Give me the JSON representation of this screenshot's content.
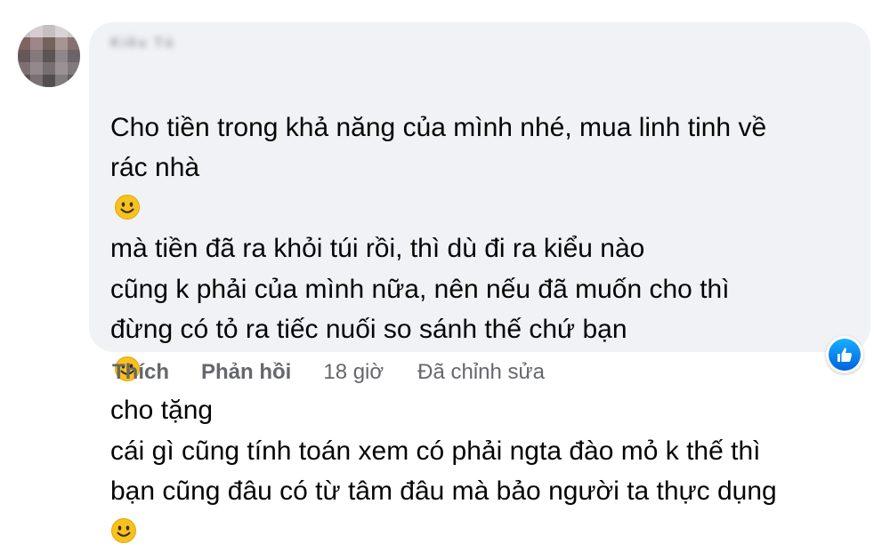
{
  "comment": {
    "author": "Kiều Tú",
    "segments": [
      {
        "type": "text",
        "value": "Cho tiền trong khả năng của mình nhé, mua linh tinh về\nrác nhà"
      },
      {
        "type": "emoji",
        "icon": "smiley-emoji-icon"
      },
      {
        "type": "text",
        "value": "mà tiền đã ra khỏi túi rồi, thì dù đi ra kiểu nào\ncũng k phải của mình nữa, nên nếu đã muốn cho thì\nđừng có tỏ ra tiếc nuối so sánh thế chứ bạn"
      },
      {
        "type": "emoji",
        "icon": "smiley-emoji-icon"
      },
      {
        "type": "text",
        "value": "cho tặng\ncái gì cũng tính toán xem có phải ngta đào mỏ k thế thì\nbạn cũng đâu có từ tâm đâu mà bảo người ta thực dụng\n"
      },
      {
        "type": "emoji",
        "icon": "smiley-emoji-icon"
      }
    ]
  },
  "actions": {
    "like": "Thích",
    "reply": "Phản hồi",
    "time": "18 giờ",
    "edited": "Đã chỉnh sửa"
  },
  "reaction": {
    "icon": "thumbs-up-icon",
    "color": "#1877f2"
  },
  "colors": {
    "bubble": "#f0f2f5",
    "meta": "#65676b",
    "text": "#050505"
  }
}
